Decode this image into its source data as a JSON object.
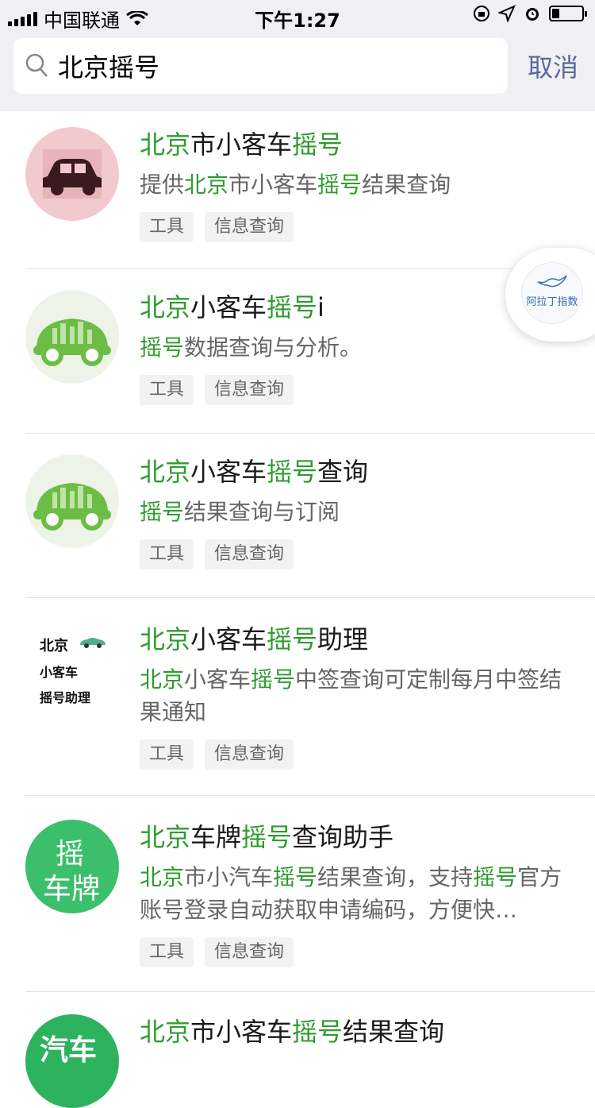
{
  "status_bar": {
    "carrier": "中国联通",
    "time": "下午1:27",
    "battery_level": 0.25
  },
  "search": {
    "query": "北京摇号",
    "cancel_label": "取消"
  },
  "floating_widget": {
    "label": "阿拉丁指数"
  },
  "results": [
    {
      "title": {
        "h1": "北京",
        "t1": "市小客车",
        "h2": "摇号",
        "t2": "",
        "t3": ""
      },
      "desc": "提供北京市小客车摇号结果查询",
      "tags": [
        "工具",
        "信息查询"
      ]
    },
    {
      "title": {
        "h1": "北京",
        "t1": "小客车",
        "h2": "摇号",
        "t2": "i"
      },
      "desc": "摇号数据查询与分析。",
      "tags": [
        "工具",
        "信息查询"
      ]
    },
    {
      "title": {
        "h1": "北京",
        "t1": "小客车",
        "h2": "摇号",
        "t2": "查询"
      },
      "desc": "摇号结果查询与订阅",
      "tags": [
        "工具",
        "信息查询"
      ]
    },
    {
      "title": {
        "h1": "北京",
        "t1": "小客车",
        "h2": "摇号",
        "t2": "助理"
      },
      "desc": "北京小客车摇号中签查询可定制每月中签结果通知",
      "avatar_text": [
        "北京",
        "小客车",
        "摇号助理"
      ],
      "tags": [
        "工具",
        "信息查询"
      ]
    },
    {
      "title": {
        "h1": "北京",
        "t1": "车牌",
        "h2": "摇号",
        "t2": "查询助手"
      },
      "desc": "北京市小汽车摇号结果查询，支持摇号官方账号登录自动获取申请编码，方便快…",
      "avatar_text": [
        "摇",
        "车牌"
      ],
      "tags": [
        "工具",
        "信息查询"
      ]
    },
    {
      "title": {
        "h1": "北京",
        "t1": "市小客车",
        "h2": "摇号",
        "t2": "结果查询"
      },
      "desc": "",
      "avatar_text": [
        "汽车"
      ],
      "tags": []
    }
  ],
  "colors": {
    "highlight": "#2f9b2f",
    "cancel": "#576b95",
    "topbar_bg": "#efeff4"
  }
}
